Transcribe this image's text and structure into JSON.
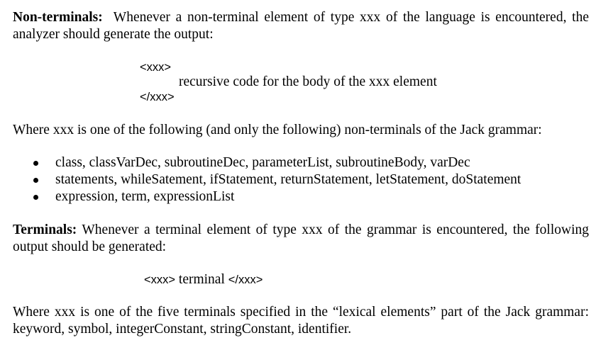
{
  "nonterminals": {
    "heading": "Non-terminals:",
    "intro": "Whenever a non-terminal element of type xxx of the language is encountered, the analyzer should generate the output:",
    "open_tag": "<xxx>",
    "body_text": "recursive code for the body of the xxx element",
    "close_tag": "</xxx>",
    "where_text": "Where xxx is one of the following (and only the following) non-terminals of the Jack grammar:",
    "list": [
      "class, classVarDec, subroutineDec, parameterList, subroutineBody, varDec",
      "statements, whileSatement, ifStatement, returnStatement, letStatement, doStatement",
      "expression, term, expressionList"
    ]
  },
  "terminals": {
    "heading": "Terminals:",
    "intro": "Whenever a terminal element of type xxx of the grammar is encountered, the following output should be generated:",
    "open_tag": "<xxx>",
    "middle": "terminal",
    "close_tag": "</xxx>",
    "where_text": "Where xxx is one of the five terminals specified in the “lexical elements” part of the Jack grammar: keyword, symbol, integerConstant, stringConstant, identifier."
  }
}
